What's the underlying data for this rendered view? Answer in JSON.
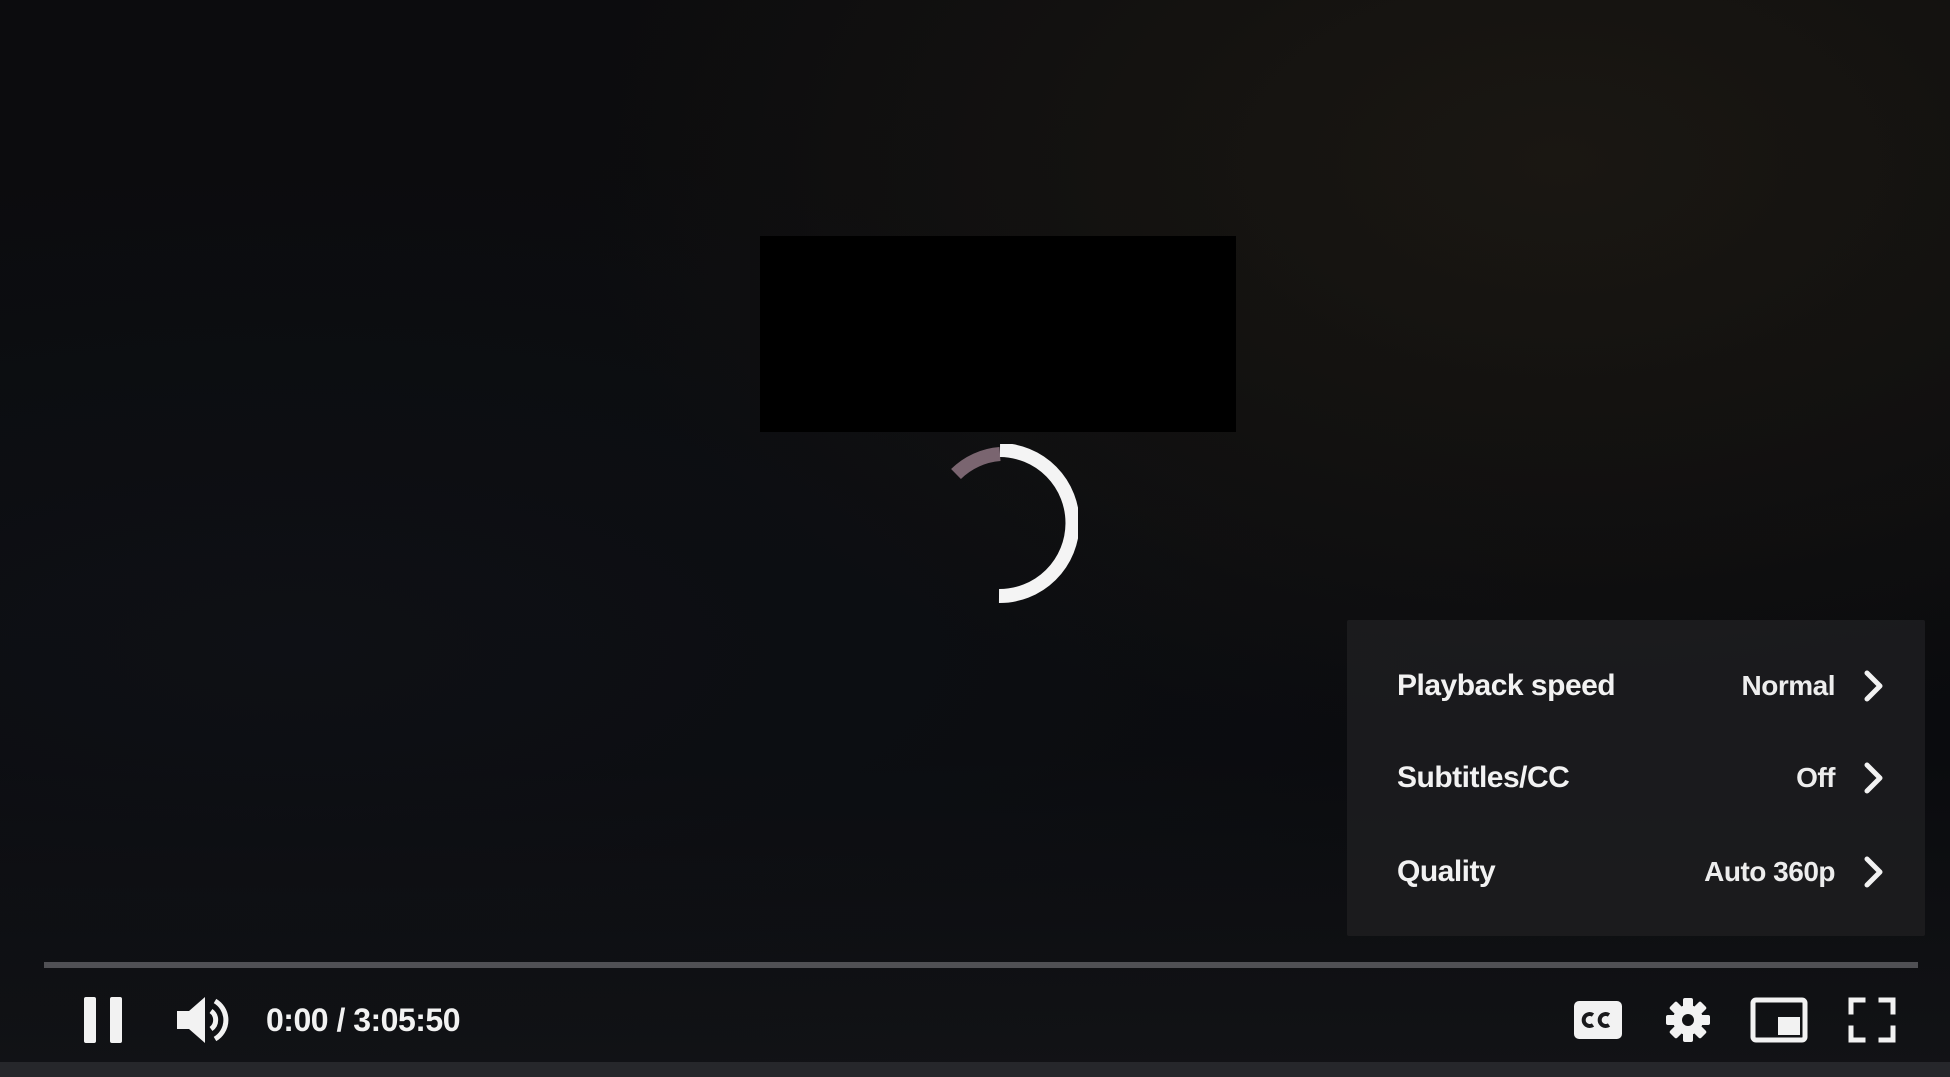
{
  "player": {
    "state": "loading",
    "progress": 0,
    "time": {
      "current": "0:00",
      "separator": " / ",
      "duration": "3:05:50"
    },
    "display_time": "0:00 / 3:05:50"
  },
  "settings_menu": {
    "items": [
      {
        "label": "Playback speed",
        "value": "Normal",
        "icon": "chevron-right-icon"
      },
      {
        "label": "Subtitles/CC",
        "value": "Off",
        "icon": "chevron-right-icon"
      },
      {
        "label": "Quality",
        "value": "Auto 360p",
        "icon": "chevron-right-icon"
      }
    ]
  },
  "controls": {
    "left": [
      "pause-icon",
      "volume-icon"
    ],
    "right": [
      "cc-icon",
      "gear-icon",
      "miniplayer-icon",
      "fullscreen-icon"
    ]
  },
  "colors": {
    "progress_track": "#8a8a8f",
    "spinner": "#ffffff",
    "menu_background": "#1c1c1e",
    "text": "#f2f2f2"
  }
}
